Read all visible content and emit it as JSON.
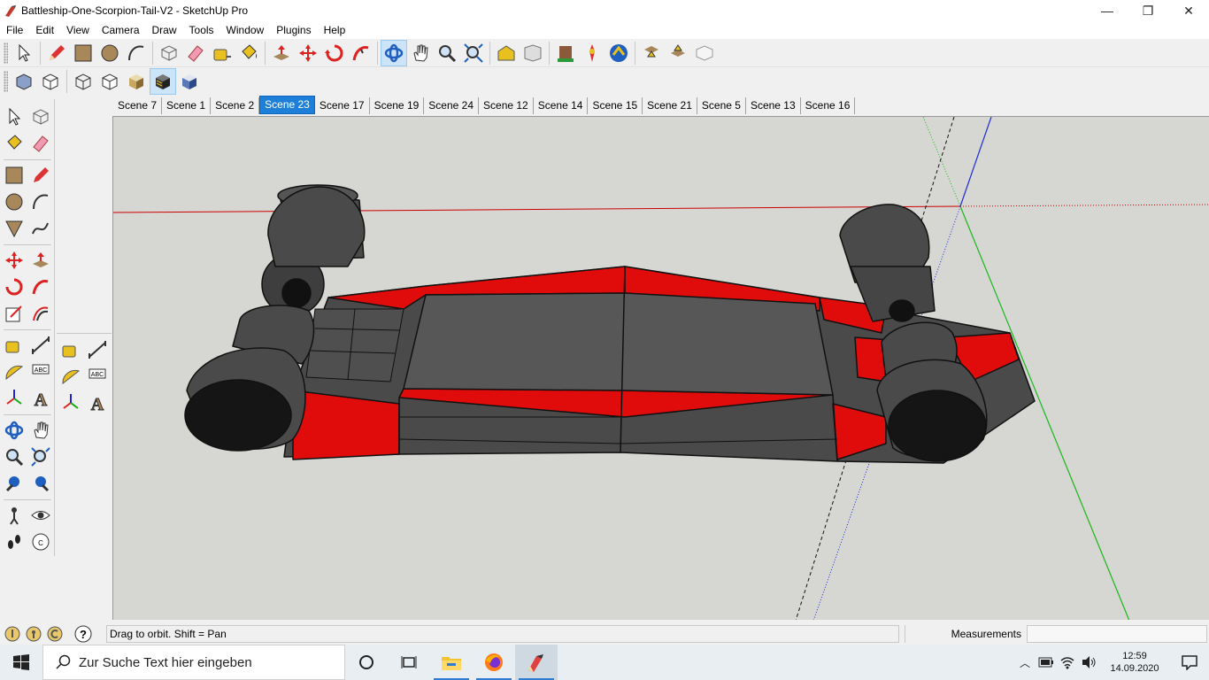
{
  "window": {
    "title": "Battleship-One-Scorpion-Tail-V2 - SketchUp Pro",
    "minimize": "—",
    "maximize": "❐",
    "close": "✕"
  },
  "menu": [
    "File",
    "Edit",
    "View",
    "Camera",
    "Draw",
    "Tools",
    "Window",
    "Plugins",
    "Help"
  ],
  "toolbar_icons": [
    "select-icon",
    "pencil-icon",
    "rectangle-icon",
    "circle-icon",
    "arc-icon",
    "make-component-icon",
    "eraser-icon",
    "tape-measure-icon",
    "paint-bucket-icon",
    "push-pull-icon",
    "move-icon",
    "rotate-icon",
    "follow-me-icon",
    "orbit-icon",
    "pan-icon",
    "zoom-icon",
    "zoom-extents-icon",
    "warehouse-icon",
    "share-model-icon",
    "components-icon",
    "extension-warehouse-icon",
    "upload-icon",
    "download-icon",
    "sandbox-icon"
  ],
  "scenes": {
    "tabs": [
      "Scene 7",
      "Scene 1",
      "Scene 2",
      "Scene 23",
      "Scene 17",
      "Scene 19",
      "Scene 24",
      "Scene 12",
      "Scene 14",
      "Scene 15",
      "Scene 21",
      "Scene 5",
      "Scene 13",
      "Scene 16"
    ],
    "active": "Scene 23"
  },
  "status": {
    "hint": "Drag to orbit.  Shift = Pan",
    "measurements_label": "Measurements",
    "measurements_value": ""
  },
  "taskbar": {
    "search_placeholder": "Zur Suche Text hier eingeben",
    "time": "12:59",
    "date": "14.09.2020"
  },
  "colors": {
    "viewport_bg": "#d6d6d3",
    "model_grey": "#545454",
    "model_red": "#e00b0b",
    "axis_red": "#cc0000",
    "axis_green": "#18b818",
    "axis_blue": "#1f2fd8",
    "active_tab": "#1e7fd8"
  }
}
